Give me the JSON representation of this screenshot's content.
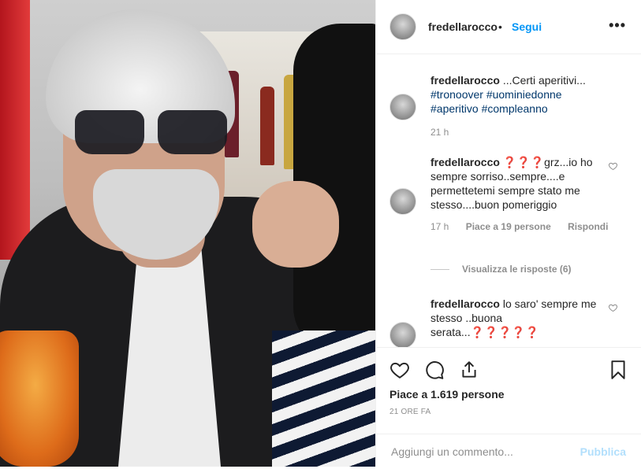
{
  "post": {
    "username": "fredellarocco",
    "separator": "•",
    "follow_label": "Segui",
    "more_label": "•••"
  },
  "caption": {
    "username": "fredellarocco",
    "text": " ...Certi aperitivi... ",
    "hashtags": [
      "#tronoover",
      "#uominiedonne",
      "#aperitivo",
      "#compleanno"
    ],
    "time": "21 h"
  },
  "comments": [
    {
      "username": "fredellarocco",
      "text": " ❓❓❓grz...io ho sempre sorriso..sempre....e permettetemi sempre stato me stesso....buon pomeriggio",
      "time": "17 h",
      "likes": "Piace a 19 persone",
      "reply_label": "Rispondi",
      "view_replies": "Visualizza le risposte (6)"
    },
    {
      "username": "fredellarocco",
      "text": " lo saro' sempre me stesso ..buona serata...❓❓❓❓❓"
    }
  ],
  "actions": {
    "likes_text": "Piace a 1.619 persone",
    "time_text": "21 ORE FA"
  },
  "add_comment": {
    "placeholder": "Aggiungi un commento...",
    "publish_label": "Pubblica"
  },
  "colors": {
    "accent": "#0095f6",
    "hashtag": "#00376b",
    "muted": "#8e8e8e",
    "publish_disabled": "#b2dffc"
  }
}
